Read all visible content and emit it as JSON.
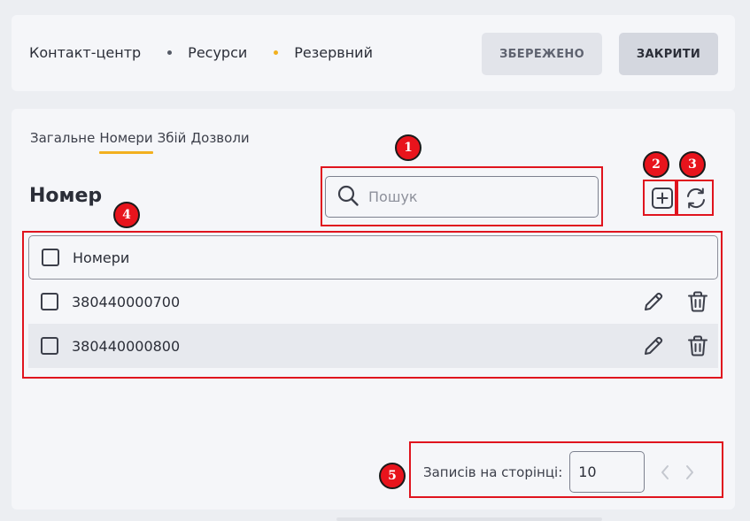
{
  "header": {
    "breadcrumbs": [
      {
        "label": "Контакт-центр"
      },
      {
        "label": "Ресурси",
        "dot_color": "#555a66"
      },
      {
        "label": "Резервний",
        "dot_color": "#f2b01e"
      }
    ],
    "saved_label": "ЗБЕРЕЖЕНО",
    "close_label": "ЗАКРИТИ"
  },
  "tabs": [
    {
      "label": "Загальне",
      "active": false
    },
    {
      "label": "Номери",
      "active": true
    },
    {
      "label": "Збій",
      "active": false
    },
    {
      "label": "Дозволи",
      "active": false
    }
  ],
  "section": {
    "title": "Номер"
  },
  "search": {
    "placeholder": "Пошук",
    "value": ""
  },
  "toolbar": {
    "add_icon": "plus-square-icon",
    "refresh_icon": "refresh-icon"
  },
  "table": {
    "header": "Номери",
    "rows": [
      {
        "number": "380440000700"
      },
      {
        "number": "380440000800"
      }
    ],
    "row_actions": [
      "edit-icon",
      "delete-icon"
    ]
  },
  "pagination": {
    "label": "Записів на сторінці:",
    "page_size": "10"
  },
  "annotations": [
    "1",
    "2",
    "3",
    "4",
    "5"
  ],
  "colors": {
    "accent": "#f2b01e",
    "annotation": "#e0141e"
  }
}
